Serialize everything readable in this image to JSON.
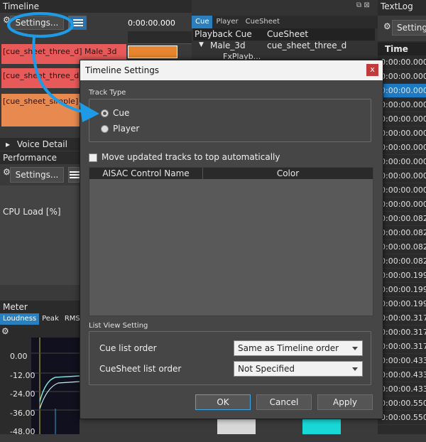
{
  "timeline": {
    "title": "Timeline",
    "settings_label": "Settings...",
    "time_display": "0:00:00.000",
    "tracks": [
      "[cue_sheet_three_d] Male_3d",
      "[cue_sheet_three_d]",
      "[cue_sheet_simple]"
    ],
    "voice_detail_label": "Voice Detail"
  },
  "cue_panel": {
    "tabs": [
      "Cue",
      "Player",
      "CueSheet"
    ],
    "columns": [
      "Playback Cue",
      "CueSheet"
    ],
    "row": {
      "cue": "Male_3d",
      "cuesheet": "cue_sheet_three_d"
    },
    "child": "FxPlayb..."
  },
  "textlog": {
    "title": "TextLog",
    "settings_label": "Settings",
    "column": "Time",
    "rows": [
      "0:00:00.000",
      "0:00:00.000",
      "0:00:00.000",
      "0:00:00.000",
      "0:00:00.000",
      "0:00:00.000",
      "0:00:00.000",
      "0:00:00.000",
      "0:00:00.000",
      "0:00:00.000",
      "0:00:00.000",
      "0:00:00.082",
      "0:00:00.082",
      "0:00:00.082",
      "0:00:00.082",
      "0:00:00.199",
      "0:00:00.199",
      "0:00:00.199",
      "0:00:00.317",
      "0:00:00.317",
      "0:00:00.317",
      "0:00:00.433",
      "0:00:00.433",
      "0:00:00.433",
      "0:00:00.550",
      "0:00:00.550"
    ]
  },
  "performance": {
    "title": "Performance",
    "settings_label": "Settings...",
    "cpu_label": "CPU Load [%]"
  },
  "meter": {
    "title": "Meter",
    "tabs": [
      "Loudness",
      "Peak",
      "RMS"
    ],
    "scale": [
      "0.00",
      "-12.00",
      "-24.00",
      "-36.00",
      "-48.00"
    ]
  },
  "dialog": {
    "title": "Timeline Settings",
    "close": "x",
    "track_type_label": "Track Type",
    "options": [
      "Cue",
      "Player"
    ],
    "move_tracks_label": "Move updated tracks to top automatically",
    "table_columns": [
      "AISAC Control Name",
      "Color"
    ],
    "list_view_label": "List View Setting",
    "cue_list_order_label": "Cue list order",
    "cue_list_order_value": "Same as Timeline order",
    "cuesheet_list_order_label": "CueSheet list order",
    "cuesheet_list_order_value": "Not Specified",
    "ok": "OK",
    "cancel": "Cancel",
    "apply": "Apply"
  },
  "colors": {
    "accent": "#1e9be6",
    "track_red": "#e85a5a",
    "track_orange": "#e88a50",
    "selection": "#1c7bc4"
  }
}
